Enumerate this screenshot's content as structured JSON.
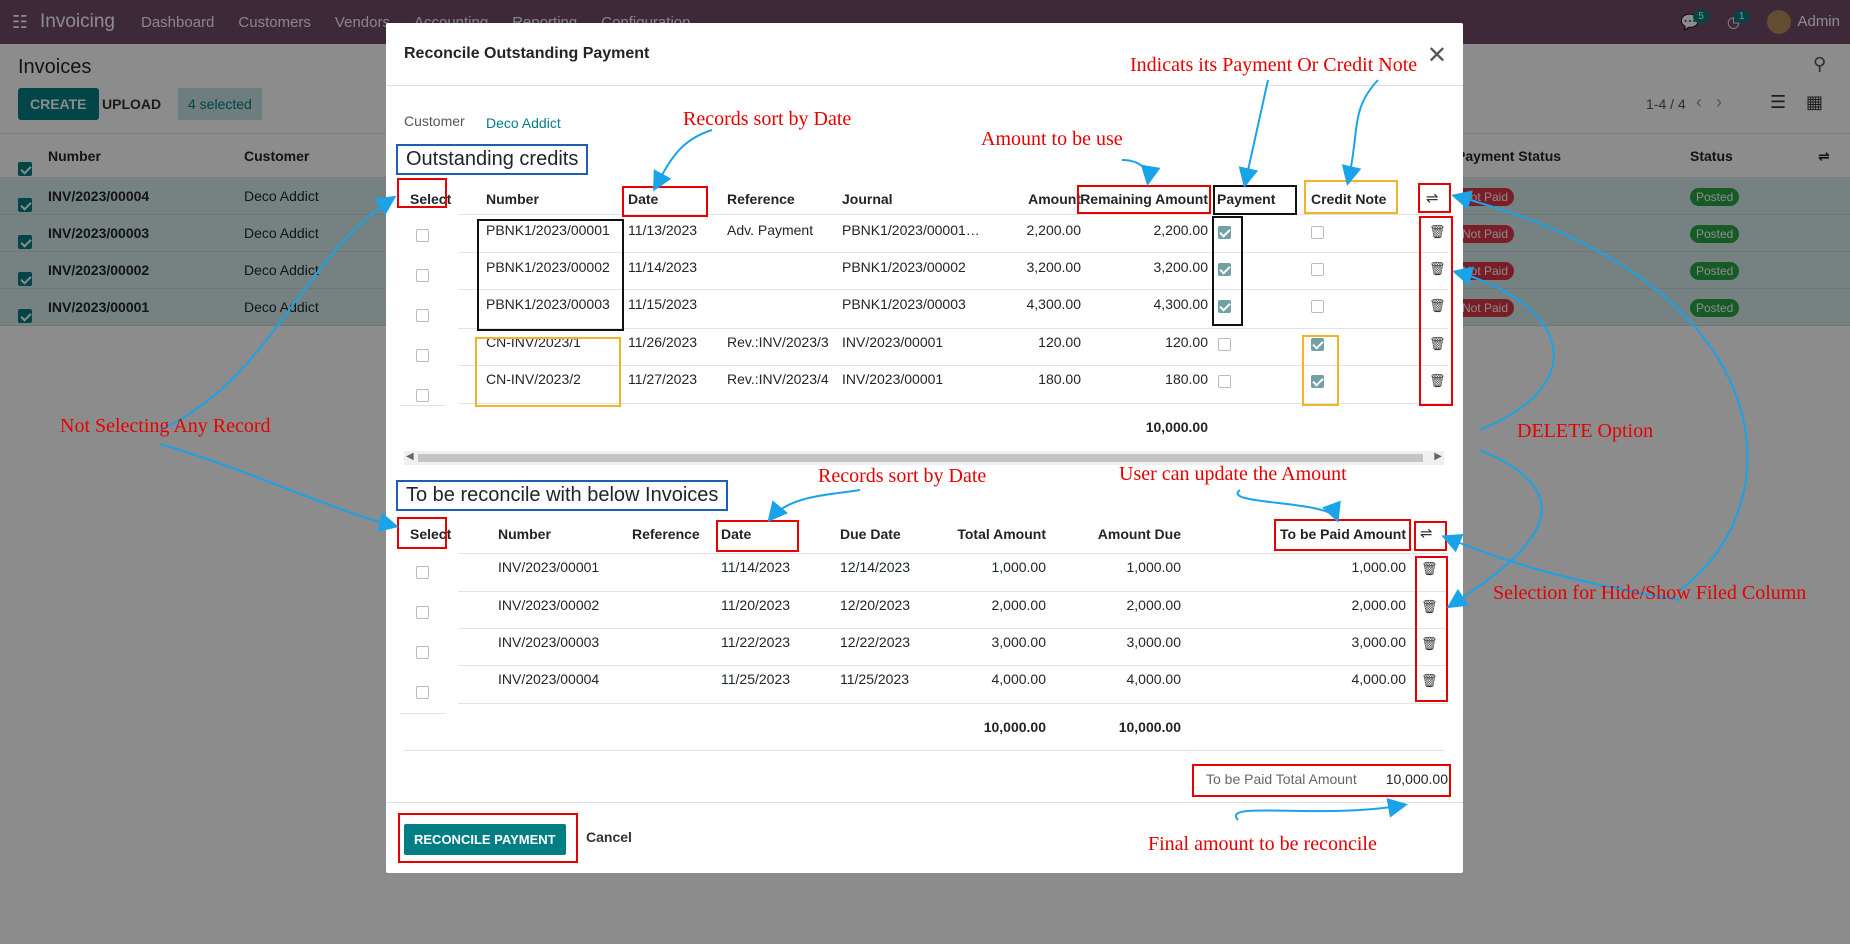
{
  "navbar": {
    "app_name": "Invoicing",
    "menus": [
      "Dashboard",
      "Customers",
      "Vendors",
      "Accounting",
      "Reporting",
      "Configuration"
    ],
    "messages_count": "5",
    "activities_count": "1",
    "user": "Admin"
  },
  "control_panel": {
    "title": "Invoices",
    "create_label": "CREATE",
    "upload_label": "UPLOAD",
    "selected_label": "4 selected",
    "pager": "1-4 / 4"
  },
  "list": {
    "headers": {
      "number": "Number",
      "customer": "Customer",
      "payment_status": "Payment Status",
      "status": "Status"
    },
    "rows": [
      {
        "number": "INV/2023/00004",
        "customer": "Deco Addict",
        "payment_status": "Not Paid",
        "status": "Posted"
      },
      {
        "number": "INV/2023/00003",
        "customer": "Deco Addict",
        "payment_status": "Not Paid",
        "status": "Posted"
      },
      {
        "number": "INV/2023/00002",
        "customer": "Deco Addict",
        "payment_status": "Not Paid",
        "status": "Posted"
      },
      {
        "number": "INV/2023/00001",
        "customer": "Deco Addict",
        "payment_status": "Not Paid",
        "status": "Posted"
      }
    ]
  },
  "modal": {
    "title": "Reconcile Outstanding Payment",
    "customer_label": "Customer",
    "customer_value": "Deco Addict",
    "credits_title": "Outstanding credits",
    "credits_headers": {
      "select": "Select",
      "number": "Number",
      "date": "Date",
      "reference": "Reference",
      "journal": "Journal",
      "amount": "Amount",
      "remaining": "Remaining Amount",
      "payment": "Payment",
      "credit_note": "Credit Note"
    },
    "credits_rows": [
      {
        "number": "PBNK1/2023/00001",
        "date": "11/13/2023",
        "reference": "Adv. Payment",
        "journal": "PBNK1/2023/00001…",
        "amount": "2,200.00",
        "remaining": "2,200.00",
        "payment": true,
        "credit_note": false
      },
      {
        "number": "PBNK1/2023/00002",
        "date": "11/14/2023",
        "reference": "",
        "journal": "PBNK1/2023/00002",
        "amount": "3,200.00",
        "remaining": "3,200.00",
        "payment": true,
        "credit_note": false
      },
      {
        "number": "PBNK1/2023/00003",
        "date": "11/15/2023",
        "reference": "",
        "journal": "PBNK1/2023/00003",
        "amount": "4,300.00",
        "remaining": "4,300.00",
        "payment": true,
        "credit_note": false
      },
      {
        "number": "CN-INV/2023/1",
        "date": "11/26/2023",
        "reference": "Rev.:INV/2023/3",
        "journal": "INV/2023/00001",
        "amount": "120.00",
        "remaining": "120.00",
        "payment": false,
        "credit_note": true
      },
      {
        "number": "CN-INV/2023/2",
        "date": "11/27/2023",
        "reference": "Rev.:INV/2023/4",
        "journal": "INV/2023/00001",
        "amount": "180.00",
        "remaining": "180.00",
        "payment": false,
        "credit_note": true
      }
    ],
    "credits_total": "10,000.00",
    "invoices_title": "To be reconcile with below Invoices",
    "invoices_headers": {
      "select": "Select",
      "number": "Number",
      "reference": "Reference",
      "date": "Date",
      "due_date": "Due Date",
      "total": "Total Amount",
      "due": "Amount Due",
      "to_pay": "To be Paid Amount"
    },
    "invoices_rows": [
      {
        "number": "INV/2023/00001",
        "date": "11/14/2023",
        "due_date": "12/14/2023",
        "total": "1,000.00",
        "due": "1,000.00",
        "to_pay": "1,000.00"
      },
      {
        "number": "INV/2023/00002",
        "date": "11/20/2023",
        "due_date": "12/20/2023",
        "total": "2,000.00",
        "due": "2,000.00",
        "to_pay": "2,000.00"
      },
      {
        "number": "INV/2023/00003",
        "date": "11/22/2023",
        "due_date": "12/22/2023",
        "total": "3,000.00",
        "due": "3,000.00",
        "to_pay": "3,000.00"
      },
      {
        "number": "INV/2023/00004",
        "date": "11/25/2023",
        "due_date": "11/25/2023",
        "total": "4,000.00",
        "due": "4,000.00",
        "to_pay": "4,000.00"
      }
    ],
    "invoices_total_total": "10,000.00",
    "invoices_total_due": "10,000.00",
    "paid_total_label": "To be Paid Total Amount",
    "paid_total_value": "10,000.00",
    "reconcile_label": "RECONCILE PAYMENT",
    "cancel_label": "Cancel"
  },
  "annotations": {
    "payment_or_credit": "Indicats its Payment Or Credit Note",
    "sort_by_date_1": "Records sort by Date",
    "amount_to_use": "Amount to be use",
    "not_selecting": "Not Selecting Any Record",
    "delete_option": "DELETE Option",
    "sort_by_date_2": "Records sort by Date",
    "user_update": "User can update the Amount",
    "hide_show": "Selection for Hide/Show Filed Column",
    "final_amount": "Final amount to be reconcile"
  },
  "colors": {
    "navbar": "#714B67",
    "primary": "#017e84",
    "annotation": "#e60000",
    "arrow": "#1aa3e8"
  }
}
